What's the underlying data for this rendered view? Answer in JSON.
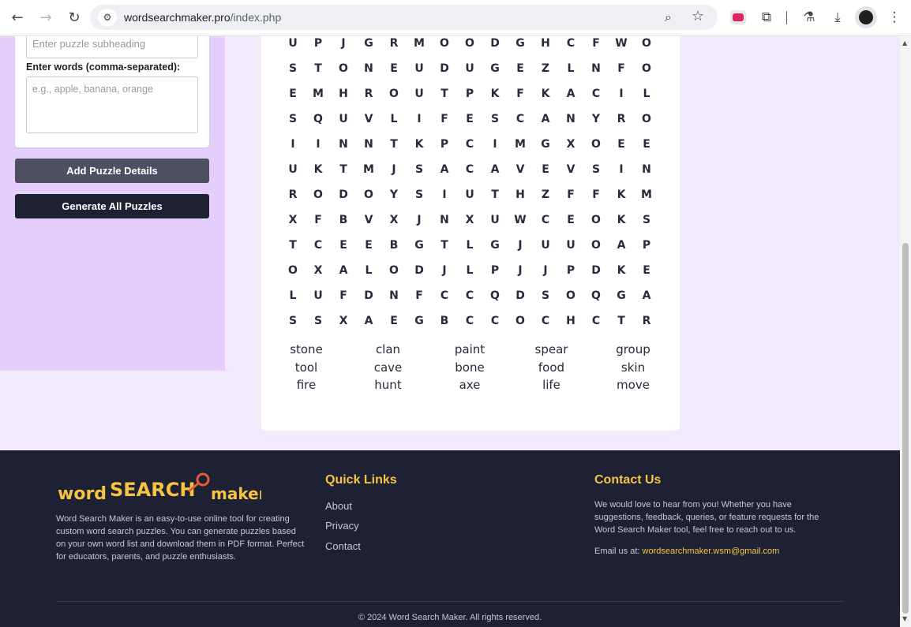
{
  "browser": {
    "url_host": "wordsearchmaker.pro",
    "url_path": "/index.php"
  },
  "form": {
    "subheading_placeholder": "Enter puzzle subheading",
    "words_label": "Enter words (comma-separated):",
    "words_placeholder": "e.g., apple, banana, orange",
    "add_details_label": "Add Puzzle Details",
    "generate_label": "Generate All Puzzles"
  },
  "puzzle": {
    "grid": [
      [
        "U",
        "P",
        "J",
        "G",
        "R",
        "M",
        "O",
        "O",
        "D",
        "G",
        "H",
        "C",
        "F",
        "W",
        "O"
      ],
      [
        "S",
        "T",
        "O",
        "N",
        "E",
        "U",
        "D",
        "U",
        "G",
        "E",
        "Z",
        "L",
        "N",
        "F",
        "O"
      ],
      [
        "E",
        "M",
        "H",
        "R",
        "O",
        "U",
        "T",
        "P",
        "K",
        "F",
        "K",
        "A",
        "C",
        "I",
        "L"
      ],
      [
        "S",
        "Q",
        "U",
        "V",
        "L",
        "I",
        "F",
        "E",
        "S",
        "C",
        "A",
        "N",
        "Y",
        "R",
        "O"
      ],
      [
        "I",
        "I",
        "N",
        "N",
        "T",
        "K",
        "P",
        "C",
        "I",
        "M",
        "G",
        "X",
        "O",
        "E",
        "E"
      ],
      [
        "U",
        "K",
        "T",
        "M",
        "J",
        "S",
        "A",
        "C",
        "A",
        "V",
        "E",
        "V",
        "S",
        "I",
        "N"
      ],
      [
        "R",
        "O",
        "D",
        "O",
        "Y",
        "S",
        "I",
        "U",
        "T",
        "H",
        "Z",
        "F",
        "F",
        "K",
        "M"
      ],
      [
        "X",
        "F",
        "B",
        "V",
        "X",
        "J",
        "N",
        "X",
        "U",
        "W",
        "C",
        "E",
        "O",
        "K",
        "S"
      ],
      [
        "T",
        "C",
        "E",
        "E",
        "B",
        "G",
        "T",
        "L",
        "G",
        "J",
        "U",
        "U",
        "O",
        "A",
        "P"
      ],
      [
        "O",
        "X",
        "A",
        "L",
        "O",
        "D",
        "J",
        "L",
        "P",
        "J",
        "J",
        "P",
        "D",
        "K",
        "E"
      ],
      [
        "L",
        "U",
        "F",
        "D",
        "N",
        "F",
        "C",
        "C",
        "Q",
        "D",
        "S",
        "O",
        "Q",
        "G",
        "A"
      ],
      [
        "S",
        "S",
        "X",
        "A",
        "E",
        "G",
        "B",
        "C",
        "C",
        "O",
        "C",
        "H",
        "C",
        "T",
        "R"
      ]
    ],
    "words": [
      "stone",
      "clan",
      "paint",
      "spear",
      "group",
      "tool",
      "cave",
      "bone",
      "food",
      "skin",
      "fire",
      "hunt",
      "axe",
      "life",
      "move"
    ]
  },
  "footer": {
    "logo_word": "word",
    "logo_search": "SEARCH",
    "logo_maker": "maker",
    "about_text": "Word Search Maker is an easy-to-use online tool for creating custom word search puzzles. You can generate puzzles based on your own word list and download them in PDF format. Perfect for educators, parents, and puzzle enthusiasts.",
    "quick_links_heading": "Quick Links",
    "links": [
      "About",
      "Privacy",
      "Contact"
    ],
    "contact_heading": "Contact Us",
    "contact_text": "We would love to hear from you! Whether you have suggestions, feedback, queries, or feature requests for the Word Search Maker tool, feel free to reach out to us.",
    "email_prefix": "Email us at: ",
    "email": "wordsearchmaker.wsm@gmail.com",
    "copyright": "© 2024 Word Search Maker. All rights reserved."
  },
  "colors": {
    "accent_yellow": "#f5c542",
    "footer_bg": "#1e2033",
    "panel_bg": "#e4cffc",
    "page_bg": "#f2e9fd"
  }
}
